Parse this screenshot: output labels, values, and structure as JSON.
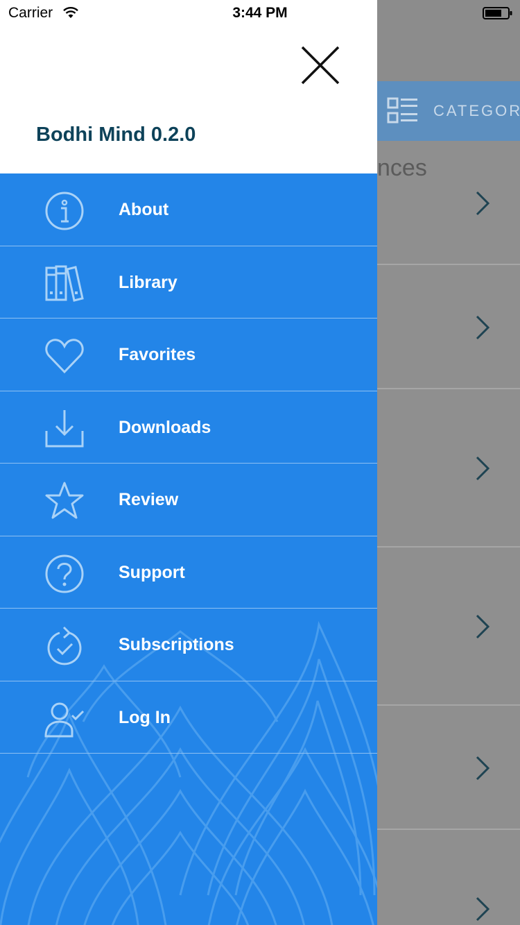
{
  "status_bar": {
    "carrier": "Carrier",
    "time": "3:44 PM"
  },
  "drawer": {
    "app_version": "Bodhi Mind 0.2.0",
    "menu": [
      {
        "label": "About",
        "icon": "info-icon"
      },
      {
        "label": "Library",
        "icon": "library-books-icon"
      },
      {
        "label": "Favorites",
        "icon": "heart-icon"
      },
      {
        "label": "Downloads",
        "icon": "download-icon"
      },
      {
        "label": "Review",
        "icon": "star-icon"
      },
      {
        "label": "Support",
        "icon": "help-icon"
      },
      {
        "label": "Subscriptions",
        "icon": "subscription-renew-icon"
      },
      {
        "label": "Log In",
        "icon": "user-check-icon"
      }
    ]
  },
  "background": {
    "tab_label": "CATEGORI",
    "row_title_fragment": "nces"
  },
  "colors": {
    "drawer_blue": "#2385e8",
    "title_teal": "#0d4259",
    "overlay_gray": "#8f8f8f"
  }
}
